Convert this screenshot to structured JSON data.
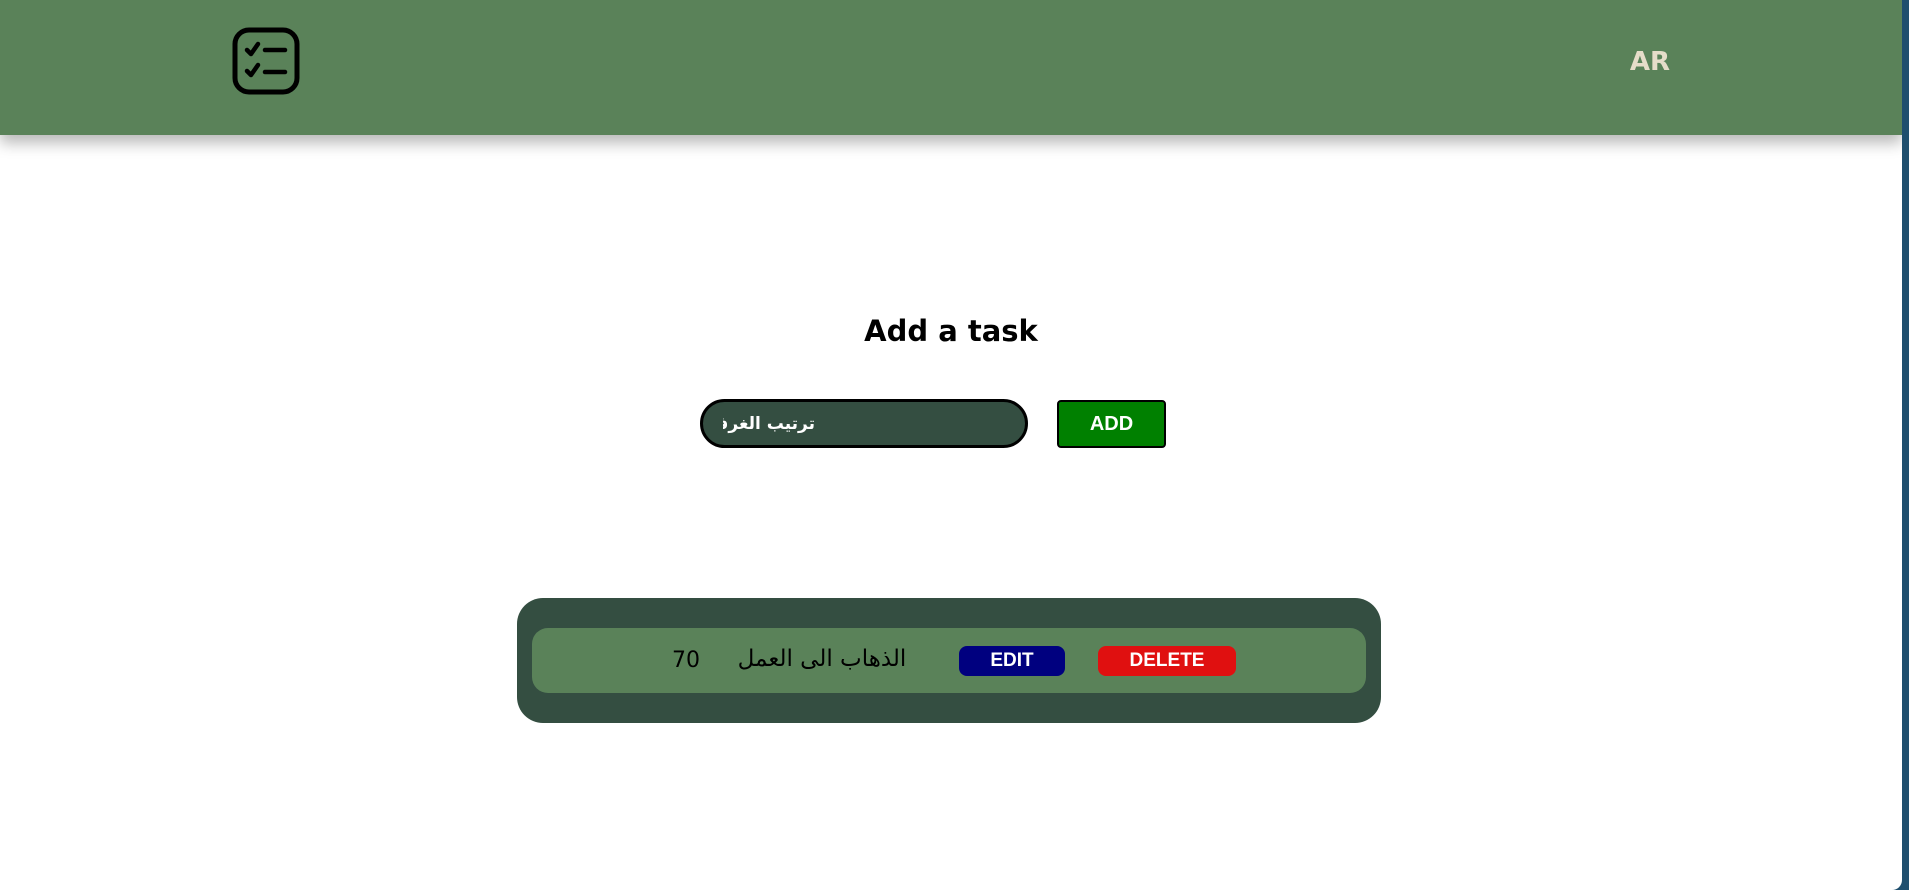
{
  "header": {
    "logo_icon": "checklist-icon",
    "language_label": "AR"
  },
  "main": {
    "title": "Add a task",
    "task_input": {
      "value": "ترتيب الغرفة",
      "placeholder": ""
    },
    "add_label": "ADD"
  },
  "tasks": [
    {
      "number": "70",
      "text": "الذهاب الى العمل",
      "edit_label": "EDIT",
      "delete_label": "DELETE"
    }
  ],
  "colors": {
    "header_bg": "#5a8259",
    "panel_bg": "#344e41",
    "add_button": "#008000",
    "edit_button": "#00007f",
    "delete_button": "#e01010",
    "language_text": "#e6ddc9"
  }
}
